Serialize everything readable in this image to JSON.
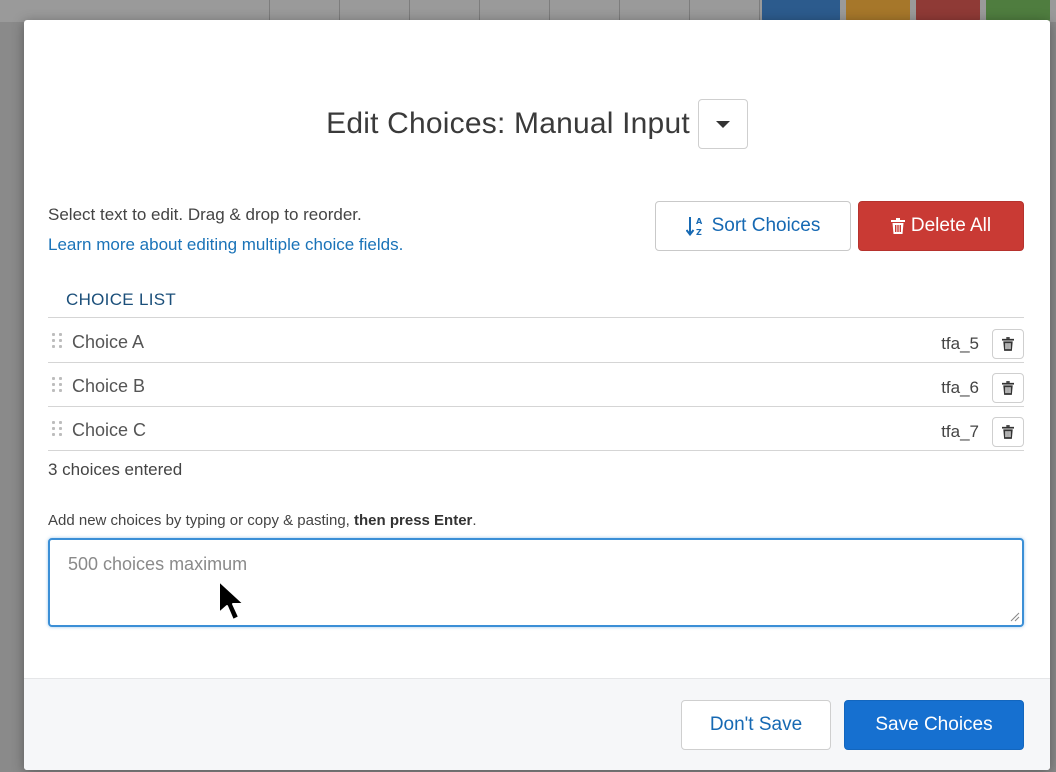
{
  "modal": {
    "title": "Edit Choices: Manual Input",
    "help_text": "Select text to edit. Drag & drop to reorder.",
    "help_link": "Learn more about editing multiple choice fields.",
    "sort_label": "Sort Choices",
    "delete_all_label": "Delete All",
    "list_header": "CHOICE LIST",
    "choices": [
      {
        "label": "Choice A",
        "code": "tfa_5"
      },
      {
        "label": "Choice B",
        "code": "tfa_6"
      },
      {
        "label": "Choice C",
        "code": "tfa_7"
      }
    ],
    "count_text": "3 choices entered",
    "add_help_prefix": "Add new choices by typing or copy & pasting, ",
    "add_help_bold": "then press Enter",
    "add_help_suffix": ".",
    "add_placeholder": "500 choices maximum",
    "dont_save_label": "Don't Save",
    "save_label": "Save Choices"
  },
  "colors": {
    "accent_blue": "#1670d0",
    "danger_red": "#c93a34",
    "link_blue": "#1a73b8"
  },
  "icons": {
    "title_dropdown": "caret-down-icon",
    "sort": "sort-alpha-icon",
    "delete_all": "trash-icon",
    "row_delete": "trash-icon",
    "row_handle": "drag-handle-icon",
    "cursor": "mouse-pointer-icon"
  }
}
